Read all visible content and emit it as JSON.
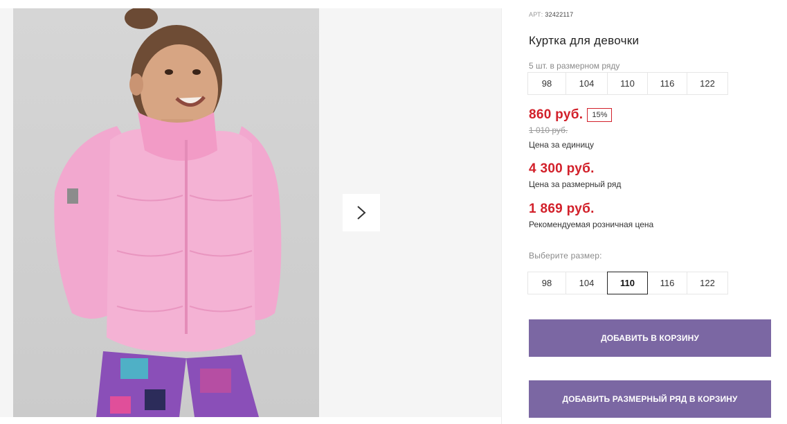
{
  "product": {
    "article_label": "АРТ:",
    "article_value": "32422117",
    "title": "Куртка для девочки",
    "pack_info": "5 шт. в размерном ряду",
    "pack_sizes": [
      "98",
      "104",
      "110",
      "116",
      "122"
    ]
  },
  "pricing": {
    "unit_price": "860 руб.",
    "discount": "15%",
    "old_price": "1 010 руб.",
    "unit_caption": "Цена за единицу",
    "row_price": "4 300 руб.",
    "row_caption": "Цена за размерный ряд",
    "rrp_price": "1 869 руб.",
    "rrp_caption": "Рекомендуемая розничная цена"
  },
  "size_select": {
    "label": "Выберите размер:",
    "options": [
      "98",
      "104",
      "110",
      "116",
      "122"
    ],
    "selected": "110"
  },
  "actions": {
    "add_to_cart": "Добавить в корзину",
    "add_row_to_cart": "Добавить размерный ряд в корзину"
  },
  "gallery": {
    "next_icon": "chevron-right-icon"
  },
  "colors": {
    "price_red": "#d2202a",
    "button_purple": "#7b67a3",
    "gallery_bg": "#f5f5f5"
  }
}
